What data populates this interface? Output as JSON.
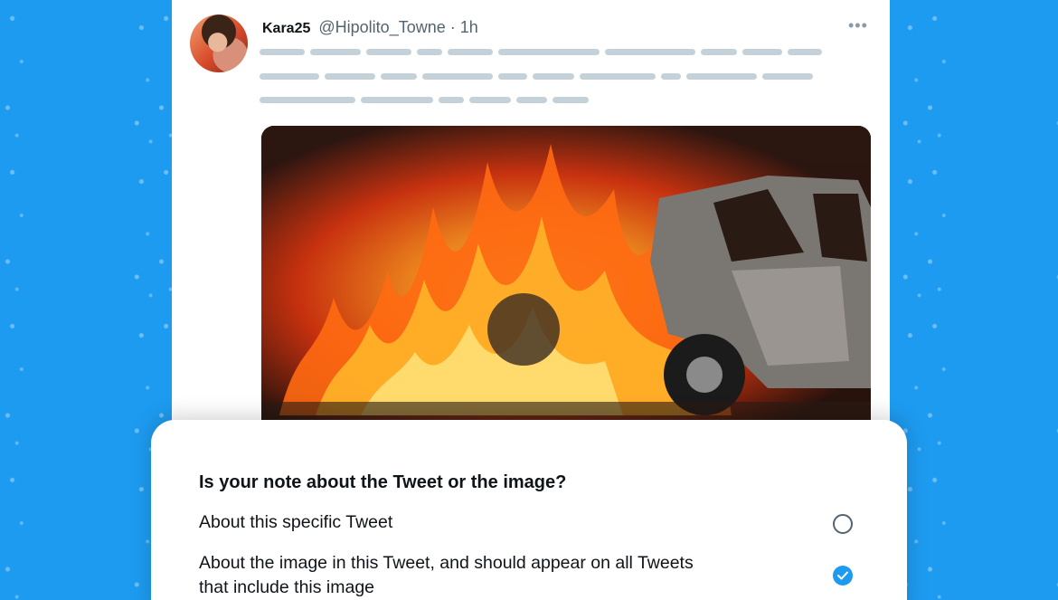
{
  "tweet": {
    "display_name": "Kara25",
    "handle": "@Hipolito_Towne",
    "time": "· 1h",
    "more_icon": "more-horizontal-icon",
    "image_alt": "burning car"
  },
  "note_panel": {
    "question": "Is your note about the Tweet or the image?",
    "options": [
      {
        "label": "About this specific Tweet",
        "selected": false
      },
      {
        "label": "About the image in this Tweet, and should appear on all Tweets that include this image",
        "selected": true
      }
    ]
  },
  "colors": {
    "background": "#1d9bf0",
    "accent": "#1d9bf0",
    "placeholder": "#c5d1d8"
  }
}
